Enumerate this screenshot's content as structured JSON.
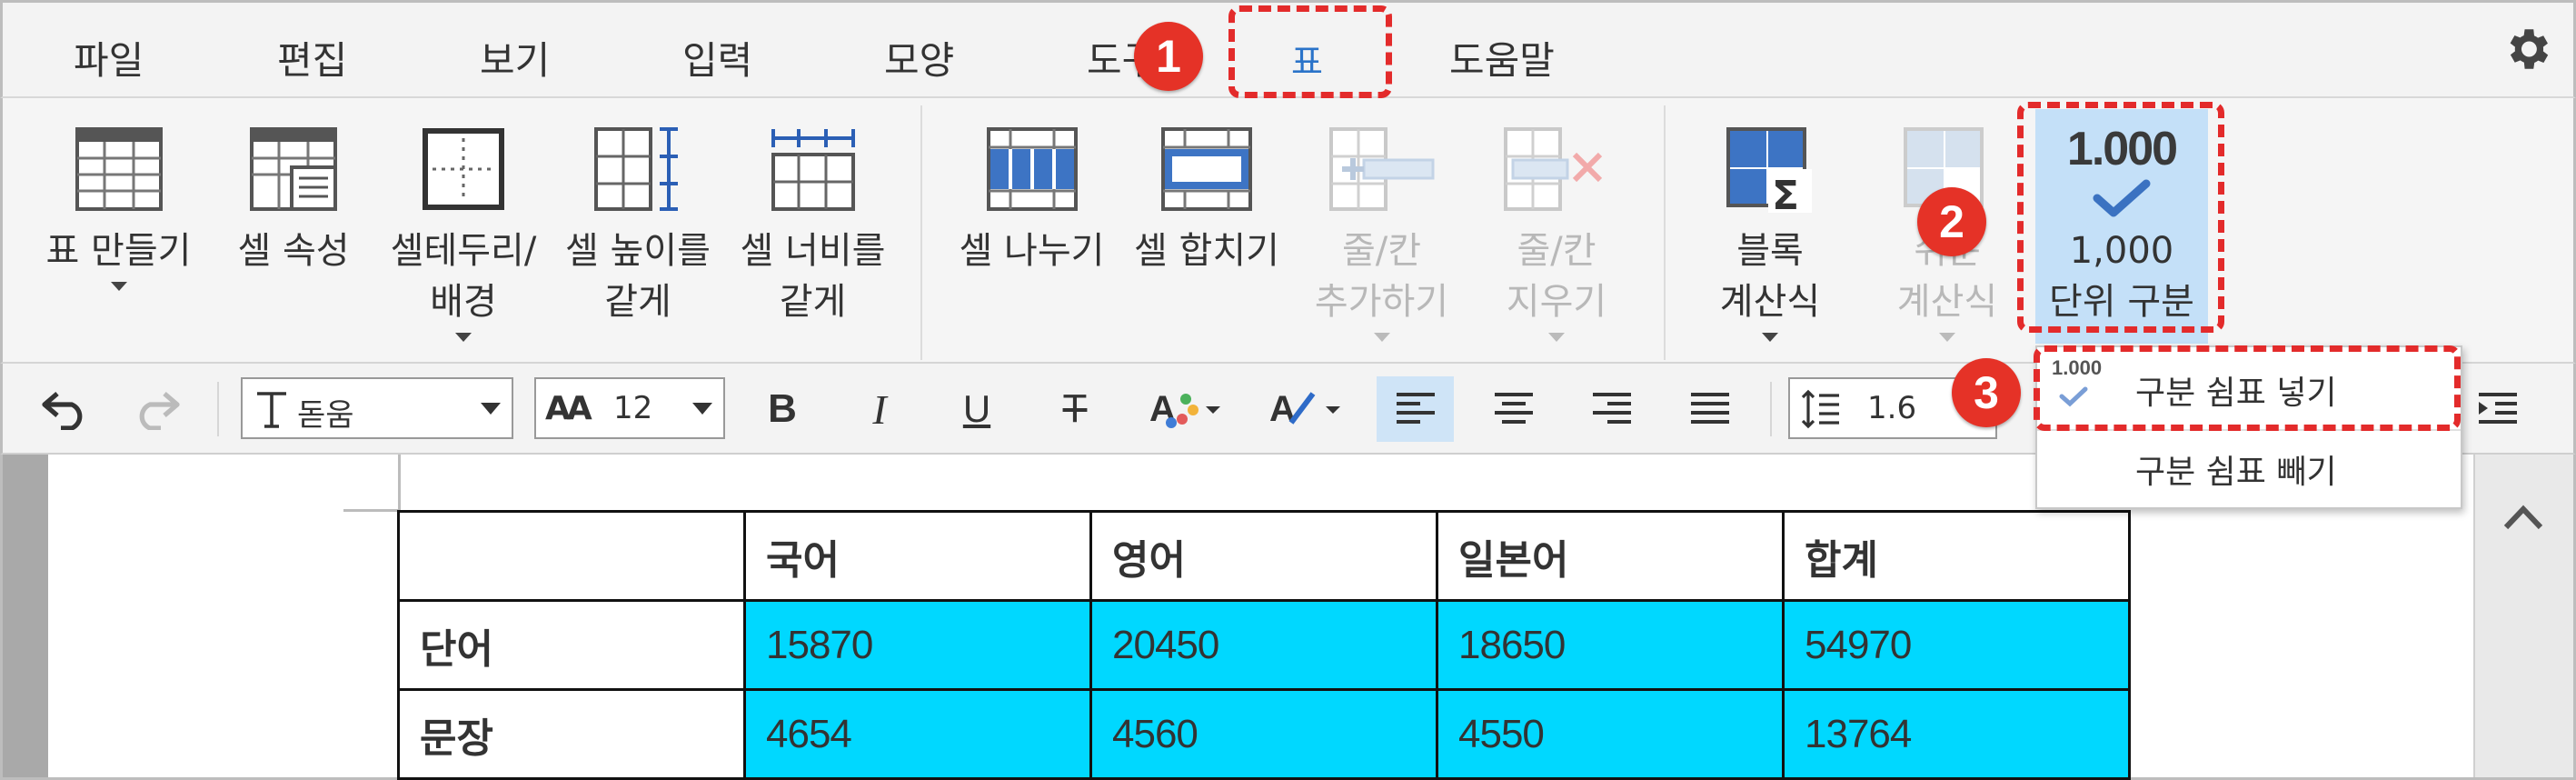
{
  "menu": {
    "items": [
      "파일",
      "편집",
      "보기",
      "입력",
      "모양",
      "도구",
      "표",
      "도움말"
    ],
    "active": "표"
  },
  "ribbon": {
    "table_create": "표 만들기",
    "cell_props": "셀 속성",
    "cell_border": "셀테두리/\n배경",
    "equal_height": "셀 높이를\n같게",
    "equal_width": "셀 너비를\n같게",
    "split_cell": "셀 나누기",
    "merge_cell": "셀 합치기",
    "insert_rowcol": "줄/칸\n추가하기",
    "delete_rowcol": "줄/칸\n지우기",
    "block_calc": "블록\n계산식",
    "easy_calc": "쉬운\n계산식",
    "thousand_icon_text": "1.000",
    "thousand_sep": "1,000\n단위 구분"
  },
  "format": {
    "font_name": "돋움",
    "font_size": "12",
    "font_size_prefix": "AA",
    "line_spacing": "1.6"
  },
  "popup": {
    "icon_text": "1.000",
    "item1": "구분 쉼표 넣기",
    "item2": "구분 쉼표 빼기"
  },
  "table": {
    "headers": [
      "",
      "국어",
      "영어",
      "일본어",
      "합계"
    ],
    "rows": [
      {
        "label": "단어",
        "values": [
          "15870",
          "20450",
          "18650",
          "54970"
        ]
      },
      {
        "label": "문장",
        "values": [
          "4654",
          "4560",
          "4550",
          "13764"
        ]
      }
    ]
  },
  "annotations": [
    "1",
    "2",
    "3"
  ],
  "colors": {
    "accent_red": "#e32b2b",
    "highlight_cyan": "#00d8ff",
    "selected_blue": "#c4e0f8",
    "menu_active": "#2a73c9"
  }
}
